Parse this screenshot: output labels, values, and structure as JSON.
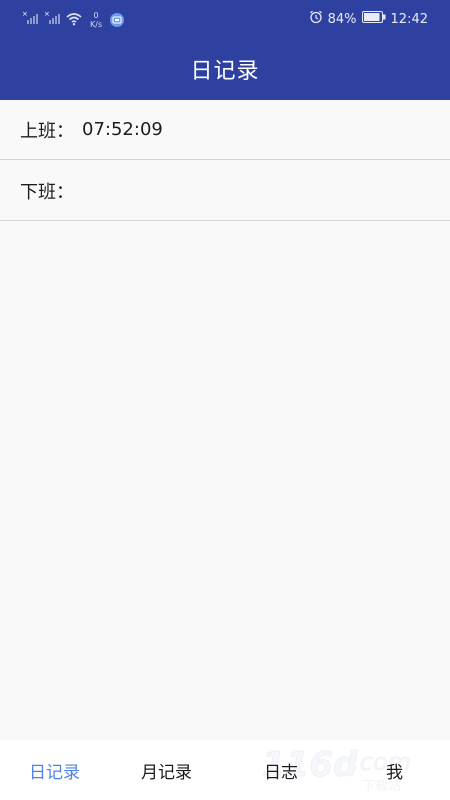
{
  "status_bar": {
    "speed_value": "0",
    "speed_unit": "K/s",
    "battery": "84%",
    "time": "12:42",
    "icons": [
      "signal-1-icon",
      "signal-2-icon",
      "wifi-icon",
      "cloud-app-icon",
      "alarm-icon",
      "battery-icon"
    ]
  },
  "app_bar": {
    "title": "日记录"
  },
  "records": [
    {
      "label": "上班",
      "colon": "：",
      "value": "07:52:09"
    },
    {
      "label": "下班",
      "colon": "：",
      "value": ""
    }
  ],
  "bottom_nav": {
    "items": [
      {
        "label": "日记录",
        "active": true
      },
      {
        "label": "月记录",
        "active": false
      },
      {
        "label": "日志",
        "active": false
      },
      {
        "label": "我",
        "active": false
      }
    ]
  },
  "watermark": {
    "text": "116d.com",
    "sub": "下载站"
  },
  "colors": {
    "primary": "#2f41a0",
    "active_tab": "#4f84e6",
    "background": "#f9f9f9",
    "divider": "#d6d6d6"
  }
}
